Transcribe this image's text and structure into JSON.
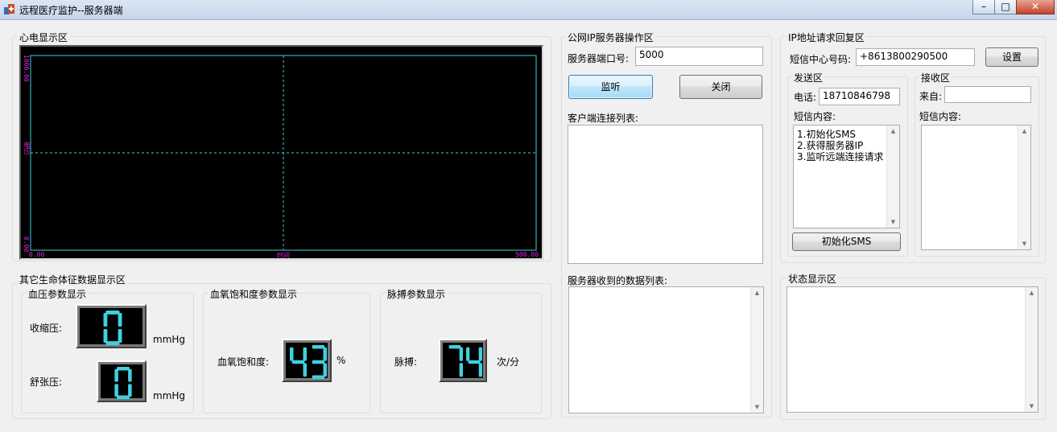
{
  "window": {
    "title": "远程医疗监护--服务器端",
    "icon": "medical-app-icon",
    "controls": [
      "minimize",
      "maximize",
      "close"
    ]
  },
  "ecg": {
    "group_label": "心电显示区",
    "x_min_label": "0.00",
    "x_mid_label": "时间",
    "x_max_label": "500.00",
    "y_top_label": "1000.00",
    "y_mid_label": "电压",
    "y_bottom_label": "0.00",
    "colors": {
      "background": "#000000",
      "grid": "#3fd0e0",
      "labels": "#e020e0"
    }
  },
  "vitals": {
    "group_label": "其它生命体征数据显示区",
    "bp": {
      "group_label": "血压参数显示",
      "systolic_label": "收缩压:",
      "systolic_value": "0",
      "diastolic_label": "舒张压:",
      "diastolic_value": "0",
      "unit": "mmHg"
    },
    "spo2": {
      "group_label": "血氧饱和度参数显示",
      "label": "血氧饱和度:",
      "value": "43",
      "unit": "%"
    },
    "pulse": {
      "group_label": "脉搏参数显示",
      "label": "脉搏:",
      "value": "74",
      "unit": "次/分"
    },
    "segment_color": "#3fd0e0"
  },
  "server": {
    "group_label": "公网IP服务器操作区",
    "port_label": "服务器端口号:",
    "port_value": "5000",
    "listen_button": "监听",
    "close_button": "关闭",
    "clients_label": "客户端连接列表:",
    "received_label": "服务器收到的数据列表:"
  },
  "sms": {
    "group_label": "IP地址请求回复区",
    "center_label": "短信中心号码:",
    "center_value": "+8613800290500",
    "settings_button": "设置",
    "send": {
      "group_label": "发送区",
      "phone_label": "电话:",
      "phone_value": "18710846798",
      "content_label": "短信内容:",
      "content_lines": [
        "1.初始化SMS",
        "2.获得服务器IP",
        "3.监听远端连接请求"
      ],
      "init_button": "初始化SMS"
    },
    "receive": {
      "group_label": "接收区",
      "from_label": "来自:",
      "from_value": "",
      "content_label": "短信内容:"
    }
  },
  "status": {
    "group_label": "状态显示区"
  }
}
